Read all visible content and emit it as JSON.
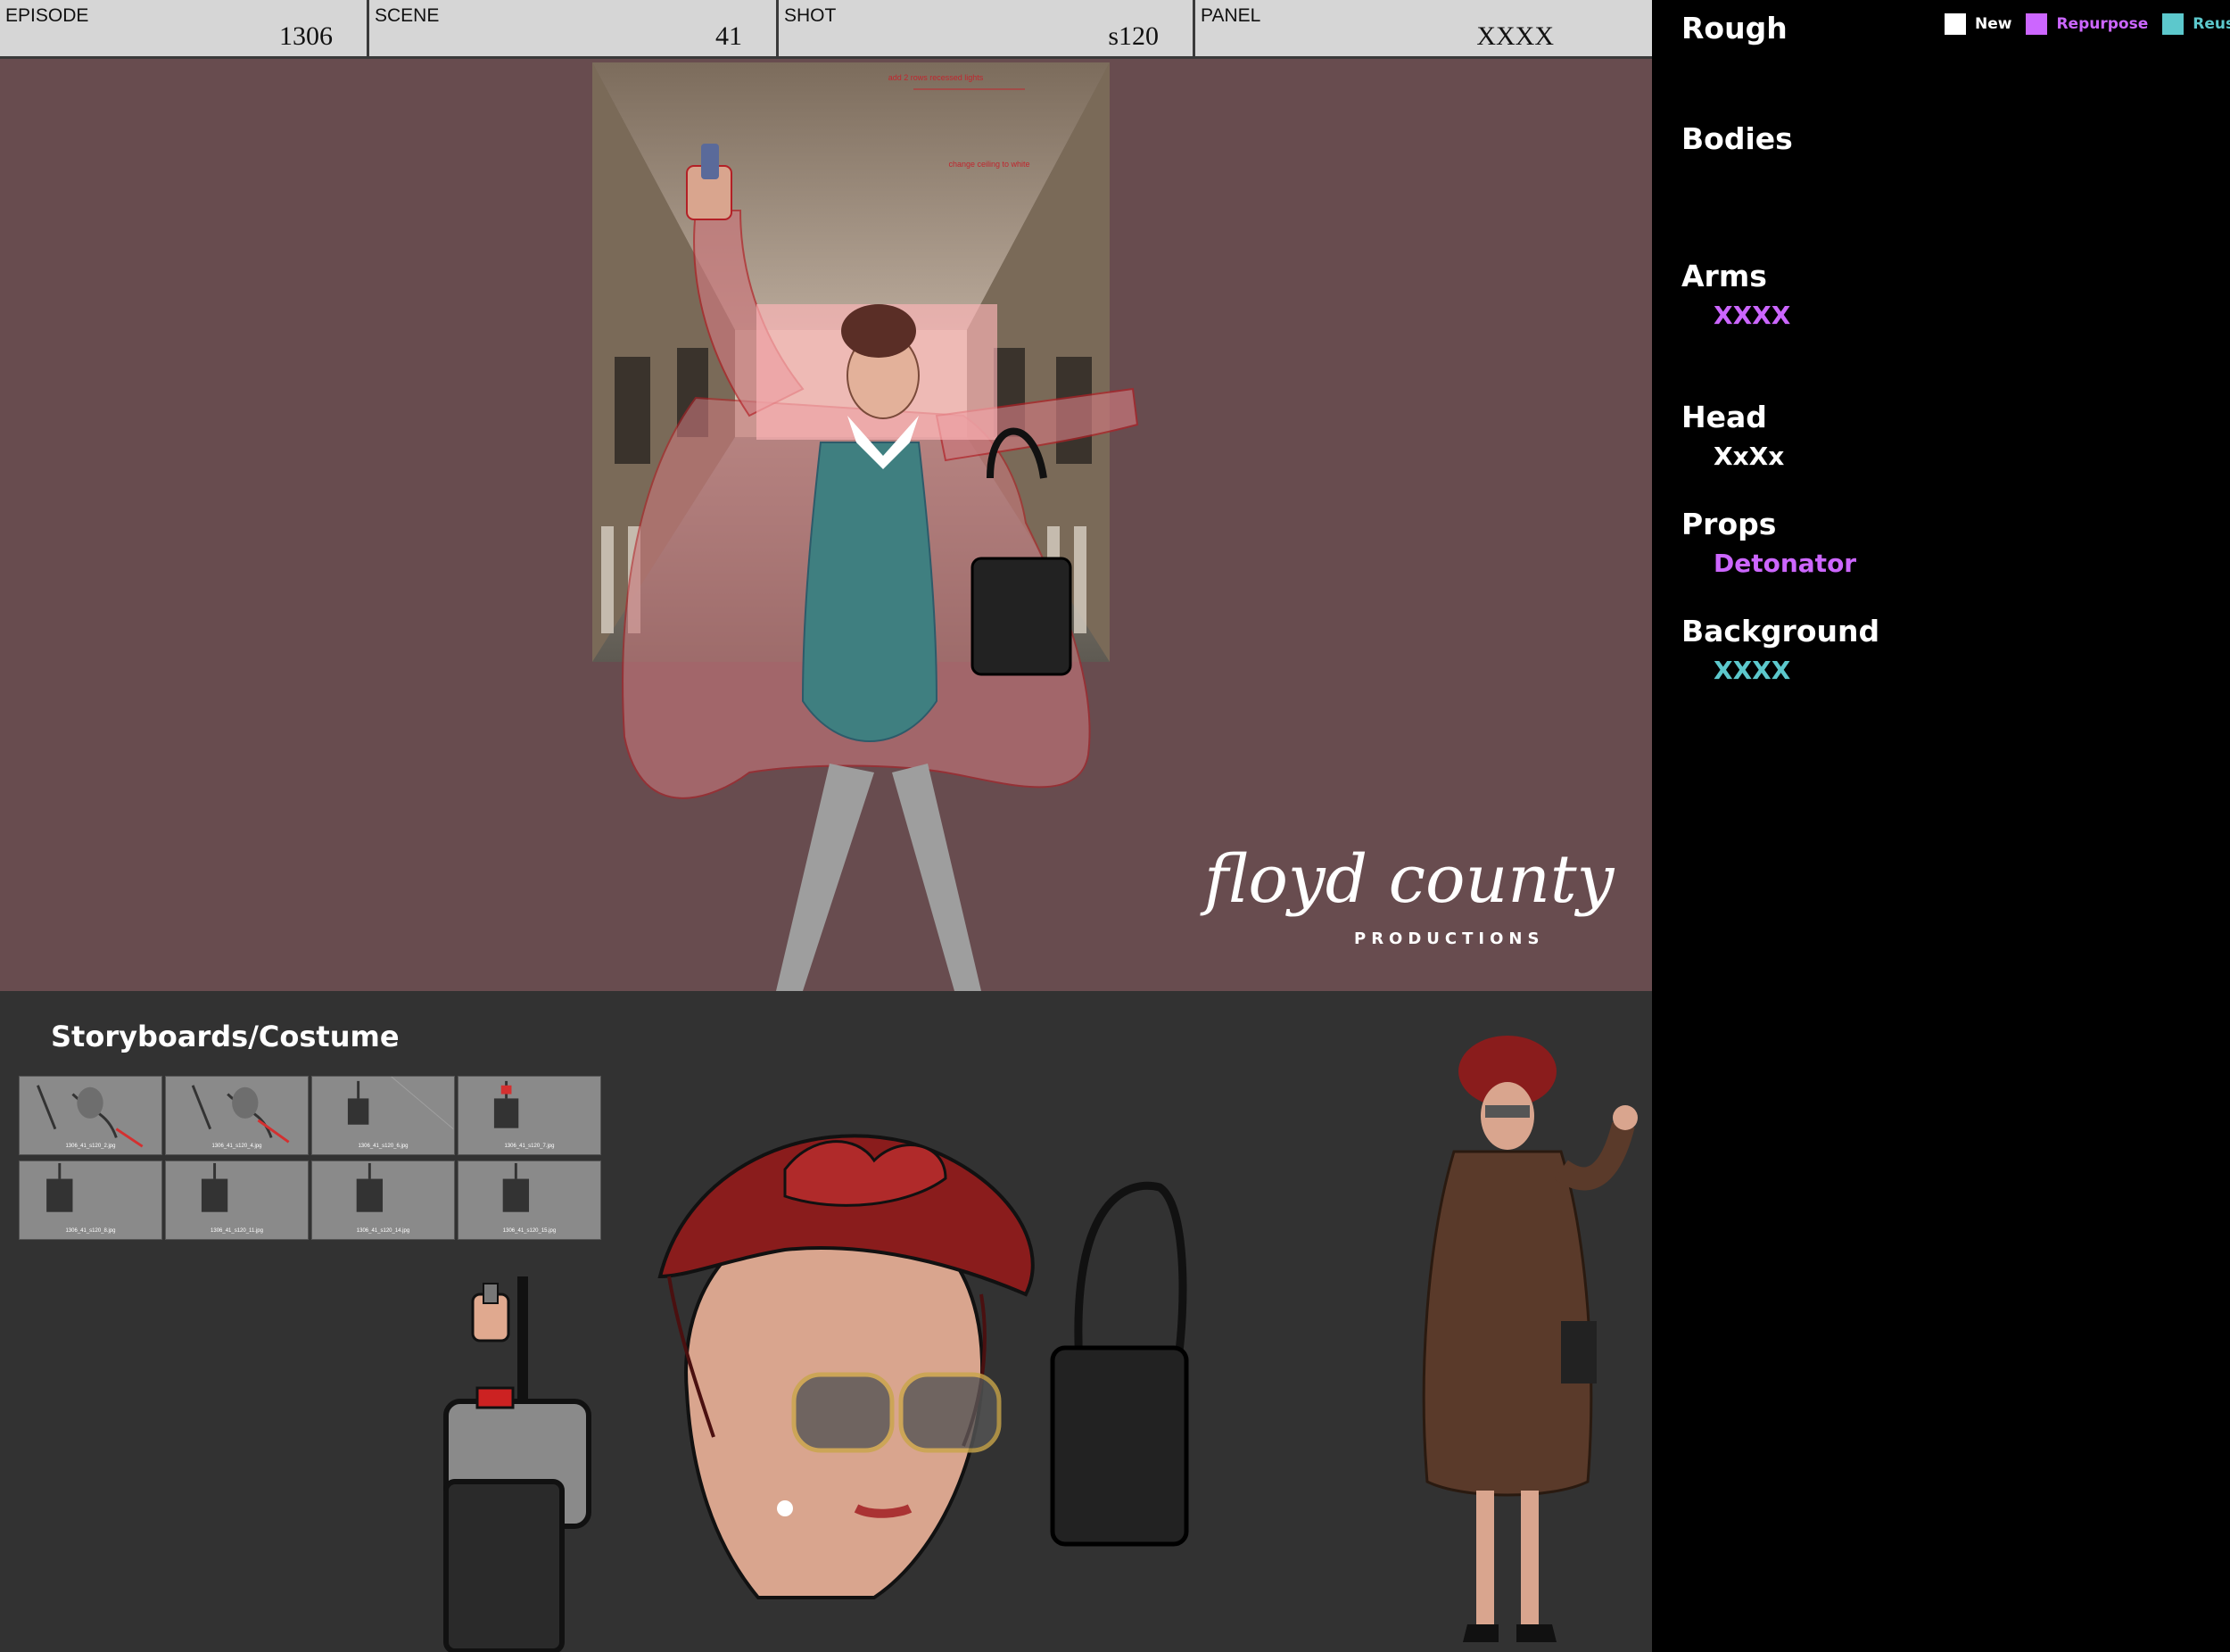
{
  "header": {
    "episode": {
      "label": "EPISODE",
      "value": "1306"
    },
    "scene": {
      "label": "SCENE",
      "value": "41"
    },
    "shot": {
      "label": "SHOT",
      "value": "s120"
    },
    "panel": {
      "label": "PANEL",
      "value": "XXXX"
    }
  },
  "notes": {
    "note1": "add 2 rows recessed lights",
    "note2": "change ceiling to white"
  },
  "logo": {
    "name": "floyd county",
    "sub": "PRODUCTIONS"
  },
  "costume": {
    "title": "Storyboards/Costume",
    "thumbnails": [
      "1306_41_s120_2.jpg",
      "1306_41_s120_4.jpg",
      "1306_41_s120_6.jpg",
      "1306_41_s120_7.jpg",
      "1306_41_s120_8.jpg",
      "1306_41_s120_11.jpg",
      "1306_41_s120_14.jpg",
      "1306_41_s120_15.jpg"
    ]
  },
  "sidebar": {
    "title": "Rough",
    "legend": [
      {
        "label": "New",
        "color": "#ffffff"
      },
      {
        "label": "Repurpose",
        "color": "#cc66ff"
      },
      {
        "label": "Reuse",
        "color": "#5cc8cc"
      }
    ],
    "sections": [
      {
        "title": "Bodies",
        "value": "",
        "color": "#ffffff"
      },
      {
        "title": "Arms",
        "value": "XXXX",
        "color": "#cc66ff"
      },
      {
        "title": "Head",
        "value": "XxXx",
        "color": "#ffffff"
      },
      {
        "title": "Props",
        "value": "Detonator",
        "color": "#cc66ff"
      },
      {
        "title": "Background",
        "value": "XXXX",
        "color": "#5cc8cc"
      }
    ]
  },
  "colors": {
    "panel_bg": "#684c4f",
    "costume_bg": "#323232",
    "markup_red": "#c0262e"
  }
}
